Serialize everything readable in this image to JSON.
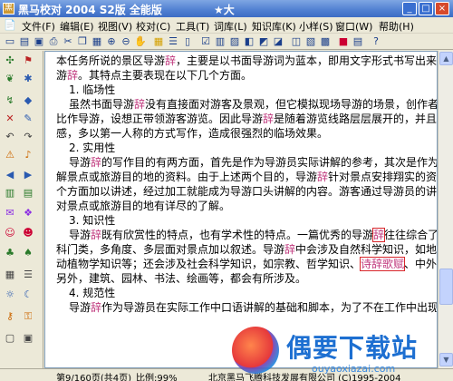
{
  "window": {
    "title": "黑马校对 2004   S2版 全能版",
    "title_tail": "★大",
    "buttons": [
      "_",
      "□",
      "×"
    ]
  },
  "menu": {
    "items": [
      "文件(F)",
      "编辑(E)",
      "视图(V)",
      "校对(C)",
      "工具(T)",
      "词库(L)",
      "知识库(K)",
      "小样(S)",
      "窗口(W)",
      "帮助(H)"
    ]
  },
  "document": {
    "lines": [
      {
        "segments": [
          {
            "t": "本任务所说的景区导游"
          },
          {
            "t": "辞",
            "kw": true
          },
          {
            "t": "，主要是以书面导游词为蓝本，即用文字形式书写出来的导"
          }
        ]
      },
      {
        "segments": [
          {
            "t": "游"
          },
          {
            "t": "辞",
            "kw": true
          },
          {
            "t": "。其特点主要表现在以下几个方面。"
          }
        ]
      },
      {
        "heading": true,
        "segments": [
          {
            "t": "1. 临场性"
          }
        ]
      },
      {
        "indent": true,
        "segments": [
          {
            "t": "虽然书面导游"
          },
          {
            "t": "辞",
            "kw": true
          },
          {
            "t": "没有直接面对游客及景观，但它模拟现场导游的场景，创作者把自己"
          }
        ]
      },
      {
        "segments": [
          {
            "t": "比作导游，设想正带领游客游览。因此导游"
          },
          {
            "t": "辞",
            "kw": true
          },
          {
            "t": "是随着游览线路层层展开的，并且为增加现场"
          }
        ]
      },
      {
        "segments": [
          {
            "t": "感，多以第一人称的方式写作，造成很强烈的临场效果。"
          }
        ]
      },
      {
        "heading": true,
        "segments": [
          {
            "t": "2. 实用性"
          }
        ]
      },
      {
        "indent": true,
        "segments": [
          {
            "t": "导游"
          },
          {
            "t": "辞",
            "kw": true
          },
          {
            "t": "的写作目的有两方面，首先是作为导游员实际讲解的参考，其次是作为游客了"
          }
        ]
      },
      {
        "segments": [
          {
            "t": "解景点或旅游目的地的资料。由于上述两个目的，导游"
          },
          {
            "t": "辞",
            "kw": true
          },
          {
            "t": "针对景点安排翔实的资料，从各"
          }
        ]
      },
      {
        "segments": [
          {
            "t": "个方面加以讲述，经过加工就能成为导游口头讲解的内容。游客通过导游员的讲解，就能"
          }
        ]
      },
      {
        "segments": [
          {
            "t": "对景点或旅游目的地有详尽的了解。"
          }
        ]
      },
      {
        "heading": true,
        "segments": [
          {
            "t": "3. 知识性"
          }
        ]
      },
      {
        "indent": true,
        "segments": [
          {
            "t": "导游"
          },
          {
            "t": "辞",
            "kw": true
          },
          {
            "t": "既有欣赏性的特点，也有学术性的特点。一篇优秀的导游"
          },
          {
            "t": "辞",
            "kw": true,
            "box": true
          },
          {
            "t": "往往综合了各个学"
          }
        ]
      },
      {
        "segments": [
          {
            "t": "科门类，多角度、多层面对景点加以叙述。导游"
          },
          {
            "t": "辞",
            "kw": true
          },
          {
            "t": "中会涉及自然科学知识，如地质成因、"
          }
        ]
      },
      {
        "segments": [
          {
            "t": "动植物学知识等；还会涉及社会科学知识，如宗教、哲学知识、"
          },
          {
            "t": "诗辞歌赋",
            "kw": true,
            "box": true
          },
          {
            "t": "、中外文学等；"
          }
        ]
      },
      {
        "segments": [
          {
            "t": "另外，建筑、园林、书法、绘画等，都会有所涉及。"
          }
        ]
      },
      {
        "heading": true,
        "segments": [
          {
            "t": "4. 规范性"
          }
        ]
      },
      {
        "indent": true,
        "segments": [
          {
            "t": "导游"
          },
          {
            "t": "辞",
            "kw": true
          },
          {
            "t": "作为导游员在实际工作中口语讲解的基础和脚本，为了不在工作中出现失误，"
          }
        ]
      }
    ]
  },
  "status": {
    "page": "第9/160页(共4页)",
    "ratio": "比例:99%",
    "right": "北京黑马飞腾科技发展有限公司 (C)1995-2004"
  },
  "watermark": {
    "title": "偶要下载站",
    "url": "ouyaoxiazai.com"
  },
  "colors": {
    "keyword": "#c0397e",
    "highlight_box": "#d8262b",
    "titlebar": "#3c6cc4"
  },
  "toolbar_icons": [
    "new-icon",
    "open-icon",
    "save-icon",
    "print-icon",
    "cut-icon",
    "copy-icon",
    "paste-icon",
    "zoom-in-icon",
    "zoom-out-icon",
    "hand-icon",
    "grid-icon",
    "list-icon",
    "page-icon",
    "check-icon",
    "table-icon",
    "chart-icon",
    "bookmark-icon",
    "find-icon",
    "replace-icon",
    "spell-icon",
    "dict-icon",
    "book-icon",
    "mark-icon",
    "note-icon",
    "help-icon"
  ],
  "left_icons": [
    "puzzle-icon",
    "flag-icon",
    "undo-icon",
    "redo-icon",
    "star-icon",
    "star2-icon",
    "arrow-left-icon",
    "arrow-right-icon",
    "warn-icon",
    "pencil-icon",
    "person-icon",
    "chat-icon",
    "bubble-icon",
    "diamond-icon",
    "book-icon",
    "cross-icon"
  ]
}
